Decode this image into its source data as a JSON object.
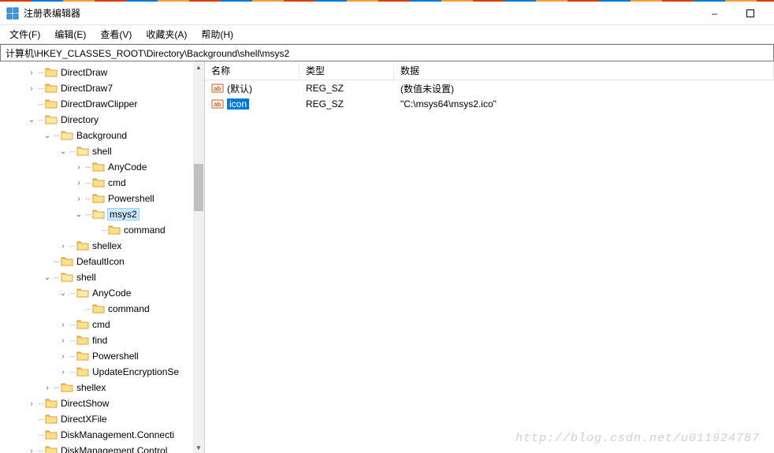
{
  "window": {
    "title": "注册表编辑器",
    "minimize": "–",
    "address": "计算机\\HKEY_CLASSES_ROOT\\Directory\\Background\\shell\\msys2"
  },
  "menu": {
    "file": "文件(F)",
    "edit": "编辑(E)",
    "view": "查看(V)",
    "favorites": "收藏夹(A)",
    "help": "帮助(H)"
  },
  "tree": {
    "n0": "DirectDraw",
    "n1": "DirectDraw7",
    "n2": "DirectDrawClipper",
    "n3": "Directory",
    "n4": "Background",
    "n5": "shell",
    "n6": "AnyCode",
    "n7": "cmd",
    "n8": "Powershell",
    "n9": "msys2",
    "n10": "command",
    "n11": "shellex",
    "n12": "DefaultIcon",
    "n13": "shell",
    "n14": "AnyCode",
    "n15": "command",
    "n16": "cmd",
    "n17": "find",
    "n18": "Powershell",
    "n19": "UpdateEncryptionSe",
    "n20": "shellex",
    "n21": "DirectShow",
    "n22": "DirectXFile",
    "n23": "DiskManagement.Connecti",
    "n24": "DiskManagement.Control"
  },
  "list": {
    "headers": {
      "name": "名称",
      "type": "类型",
      "data": "数据"
    },
    "rows": [
      {
        "name": "(默认)",
        "type": "REG_SZ",
        "data": "(数值未设置)"
      },
      {
        "name": "icon",
        "type": "REG_SZ",
        "data": "\"C:\\msys64\\msys2.ico\""
      }
    ]
  },
  "watermark": "http://blog.csdn.net/u011924787"
}
